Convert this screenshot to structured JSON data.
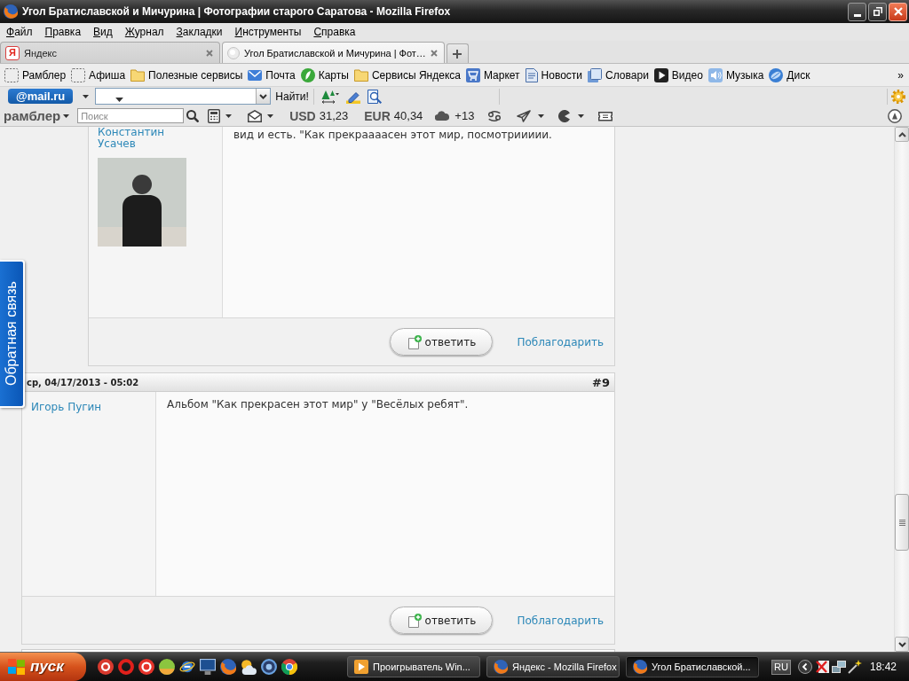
{
  "window": {
    "title": "Угол Братиславской и Мичурина | Фотографии старого Саратова - Mozilla Firefox"
  },
  "menu": [
    "Файл",
    "Правка",
    "Вид",
    "Журнал",
    "Закладки",
    "Инструменты",
    "Справка"
  ],
  "tabs": [
    {
      "label": "Яндекс",
      "icon_text": "Я",
      "selected": false
    },
    {
      "label": "Угол Братиславской и Мичурина | Фот…",
      "selected": true
    }
  ],
  "bookmarks": {
    "items": [
      "Рамблер",
      "Афиша",
      "Полезные сервисы",
      "Почта",
      "Карты",
      "Сервисы Яндекса",
      "Маркет",
      "Новости",
      "Словари",
      "Видео",
      "Музыка",
      "Диск"
    ],
    "overflow": "»"
  },
  "mailru_toolbar": {
    "logo": "@mail.ru",
    "find_button": "Найти!"
  },
  "rambler_toolbar": {
    "logo": "рамблер",
    "search": {
      "placeholder": "Поиск"
    },
    "currencies": [
      {
        "code": "USD",
        "rate": "31,23"
      },
      {
        "code": "EUR",
        "rate": "40,34"
      }
    ],
    "weather": "+13"
  },
  "feedback_tab": "Обратная связь",
  "posts": [
    {
      "nested": true,
      "author": "Константин Усачев",
      "photo": true,
      "text": "вид и есть. \"Как прекраааасен этот мир, посмотриииии.",
      "reply_button": "ответить",
      "thank_link": "Поблагодарить"
    },
    {
      "nested": false,
      "date": "ср, 04/17/2013 - 05:02",
      "number": "#9",
      "author": "Игорь Пугин",
      "text": "Альбом \"Как прекрасен этот мир\" у \"Весёлых ребят\".",
      "reply_button": "ответить",
      "thank_link": "Поблагодарить"
    }
  ],
  "taskbar": {
    "start": "пуск",
    "tasks": [
      {
        "label": "Проигрыватель Win...",
        "selected": false
      },
      {
        "label": "Яндекс - Mozilla Firefox",
        "selected": false
      },
      {
        "label": "Угол Братиславской...",
        "selected": true
      }
    ],
    "language": "RU",
    "clock": "18:42"
  }
}
